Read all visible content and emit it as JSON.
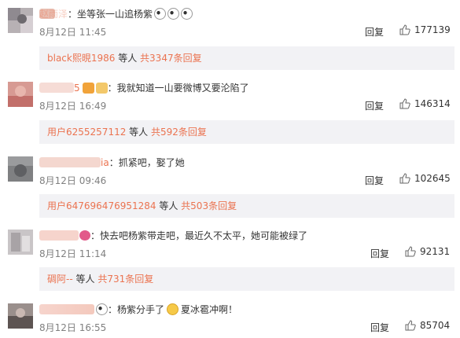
{
  "comments": [
    {
      "name": "赵雨泽",
      "text": "：坐等张一山追杨紫",
      "emoji": [
        "panda-face-icon",
        "panda-face-icon",
        "panda-face-icon"
      ],
      "date": "8月12日 11:45",
      "reply": "回复",
      "likes": "177139",
      "sub_user": "black熙晛1986",
      "sub_mid": " 等人 ",
      "sub_more": "共3347条回复"
    },
    {
      "name": "5",
      "text": "：我就知道一山要微博又要沦陷了",
      "date": "8月12日 16:49",
      "reply": "回复",
      "likes": "146314",
      "sub_user": "用户6255257112",
      "sub_mid": " 等人 ",
      "sub_more": "共592条回复"
    },
    {
      "name": "ia",
      "text": "：抓紧吧，娶了她",
      "date": "8月12日 09:46",
      "reply": "回复",
      "likes": "102645",
      "sub_user": "用户647696476951284",
      "sub_mid": " 等人 ",
      "sub_more": "共503条回复"
    },
    {
      "name": "",
      "text": "：快去吧杨紫带走吧，最近久不太平，她可能被绿了",
      "date": "8月12日 11:14",
      "reply": "回复",
      "likes": "92131",
      "sub_user": "碉阿--",
      "sub_mid": " 等人 ",
      "sub_more": "共731条回复"
    },
    {
      "name": "",
      "text": "：杨紫分手了",
      "text2": "夏冰雹冲啊！",
      "date": "8月12日 16:55",
      "reply": "回复",
      "likes": "85704"
    }
  ],
  "colors": {
    "accent": "#eb7350",
    "subbox_bg": "#f2f2f5",
    "meta": "#808080"
  }
}
